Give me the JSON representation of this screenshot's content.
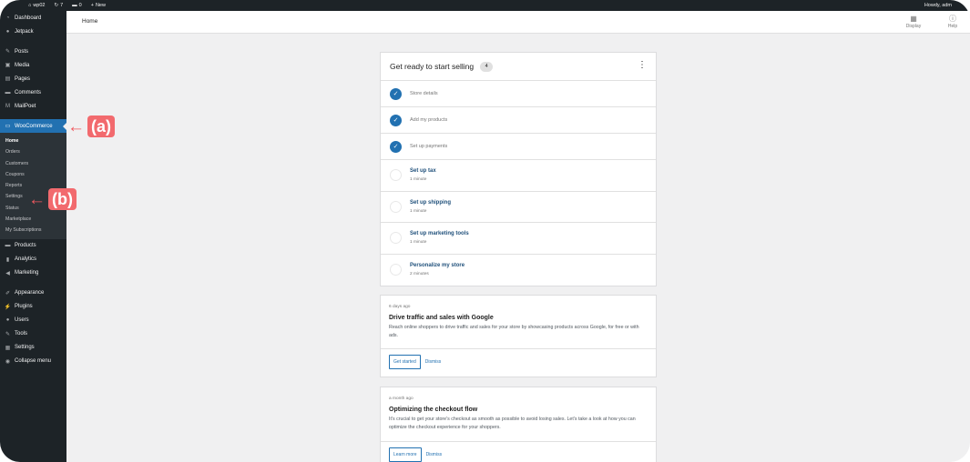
{
  "admin_bar": {
    "site_name": "wp02",
    "updates": "7",
    "comments": "0",
    "new_label": "New",
    "howdy": "Howdy, adm"
  },
  "sidebar": {
    "items_top": [
      {
        "label": "Dashboard",
        "icon": "dashboard-icon",
        "glyph": "◔"
      },
      {
        "label": "Jetpack",
        "icon": "jetpack-icon",
        "glyph": "●"
      }
    ],
    "items_content": [
      {
        "label": "Posts",
        "icon": "pin-icon",
        "glyph": "✎"
      },
      {
        "label": "Media",
        "icon": "media-icon",
        "glyph": "▣"
      },
      {
        "label": "Pages",
        "icon": "pages-icon",
        "glyph": "▤"
      },
      {
        "label": "Comments",
        "icon": "comment-icon",
        "glyph": "▬"
      },
      {
        "label": "MailPoet",
        "icon": "mailpoet-icon",
        "glyph": "M"
      }
    ],
    "woocommerce": {
      "label": "WooCommerce",
      "icon": "woocommerce-icon",
      "glyph": "▭"
    },
    "woo_submenu": [
      "Home",
      "Orders",
      "Customers",
      "Coupons",
      "Reports",
      "Settings",
      "Status",
      "Marketplace",
      "My Subscriptions"
    ],
    "items_store": [
      {
        "label": "Products",
        "icon": "products-icon",
        "glyph": "▬"
      },
      {
        "label": "Analytics",
        "icon": "analytics-icon",
        "glyph": "▮"
      },
      {
        "label": "Marketing",
        "icon": "megaphone-icon",
        "glyph": "◀"
      }
    ],
    "items_admin": [
      {
        "label": "Appearance",
        "icon": "paintbrush-icon",
        "glyph": "✐"
      },
      {
        "label": "Plugins",
        "icon": "plugin-icon",
        "glyph": "⚡"
      },
      {
        "label": "Users",
        "icon": "users-icon",
        "glyph": "●"
      },
      {
        "label": "Tools",
        "icon": "wrench-icon",
        "glyph": "✎"
      },
      {
        "label": "Settings",
        "icon": "settings-icon",
        "glyph": "▦"
      },
      {
        "label": "Collapse menu",
        "icon": "collapse-icon",
        "glyph": "◉"
      }
    ]
  },
  "header": {
    "title": "Home",
    "display_label": "Display",
    "help_label": "Help"
  },
  "tasks": {
    "title": "Get ready to start selling",
    "count": "4",
    "items": [
      {
        "label": "Store details",
        "done": true,
        "time": ""
      },
      {
        "label": "Add my products",
        "done": true,
        "time": ""
      },
      {
        "label": "Set up payments",
        "done": true,
        "time": ""
      },
      {
        "label": "Set up tax",
        "done": false,
        "time": "1 minute"
      },
      {
        "label": "Set up shipping",
        "done": false,
        "time": "1 minute"
      },
      {
        "label": "Set up marketing tools",
        "done": false,
        "time": "1 minute"
      },
      {
        "label": "Personalize my store",
        "done": false,
        "time": "2 minutes"
      }
    ]
  },
  "notes": [
    {
      "date": "6 days ago",
      "title": "Drive traffic and sales with Google",
      "body": "Reach online shoppers to drive traffic and sales for your store by showcasing products across Google, for free or with ads.",
      "primary": "Get started",
      "secondary": "Dismiss"
    },
    {
      "date": "a month ago",
      "title": "Optimizing the checkout flow",
      "body": "It's crucial to get your store's checkout as smooth as possible to avoid losing sales. Let's take a look at how you can optimize the checkout experience for your shoppers.",
      "primary": "Learn more",
      "secondary": "Dismiss"
    }
  ],
  "annotations": {
    "a": "(a)",
    "b": "(b)"
  },
  "colors": {
    "sidebar": "#1d2327",
    "accent": "#2271b1",
    "annotation": "#f26a6e"
  }
}
